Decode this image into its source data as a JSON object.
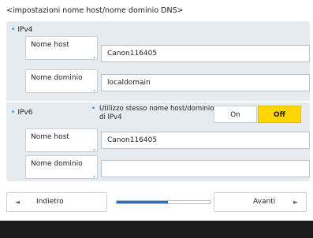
{
  "page_title": "<impostazioni nome host/nome dominio DNS>",
  "ipv4": {
    "section_label": "IPv4",
    "host_label": "Nome host",
    "host_value": "Canon116405",
    "domain_label": "Nome dominio",
    "domain_value": "localdomain"
  },
  "ipv6": {
    "section_label": "IPv6",
    "same_as_ipv4_label": "Utilizzo stesso nome host/dominio di IPv4",
    "toggle_on": "On",
    "toggle_off": "Off",
    "toggle_selected": "Off",
    "host_label": "Nome host",
    "host_value": "Canon116405",
    "domain_label": "Nome dominio",
    "domain_value": ""
  },
  "label_corner_mark": ",",
  "nav": {
    "back_label": "Indietro",
    "next_label": "Avanti",
    "back_arrow": "◄",
    "next_arrow": "►",
    "progress_fraction": 0.55
  },
  "colors": {
    "accent_bullet": "#1e8fd5",
    "selected_toggle": "#ffd600",
    "progress_fill": "#1e6fd5",
    "panel_bg": "#e6ebf0",
    "footer_bg": "#1b1b1b"
  }
}
